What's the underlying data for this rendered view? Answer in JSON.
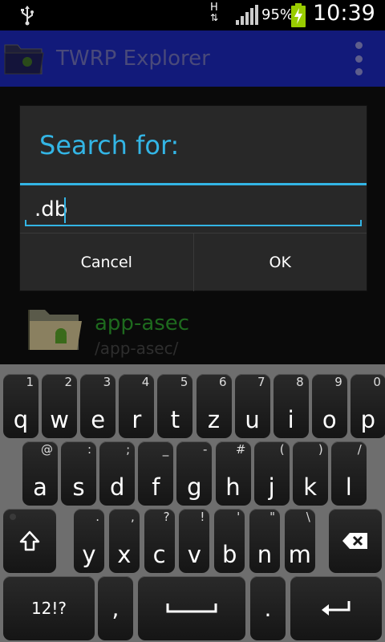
{
  "status_bar": {
    "network_type": "H",
    "battery_percent": "95%",
    "time": "10:39"
  },
  "app_bar": {
    "title": "TWRP Explorer"
  },
  "list": {
    "items": [
      {
        "name": "app-asec",
        "path": "/app-asec/"
      }
    ]
  },
  "dialog": {
    "title": "Search for:",
    "input_value": ".db",
    "cancel_label": "Cancel",
    "ok_label": "OK"
  },
  "keyboard": {
    "row1": [
      {
        "main": "q",
        "sub": "1"
      },
      {
        "main": "w",
        "sub": "2"
      },
      {
        "main": "e",
        "sub": "3"
      },
      {
        "main": "r",
        "sub": "4"
      },
      {
        "main": "t",
        "sub": "5"
      },
      {
        "main": "z",
        "sub": "6"
      },
      {
        "main": "u",
        "sub": "7"
      },
      {
        "main": "i",
        "sub": "8"
      },
      {
        "main": "o",
        "sub": "9"
      },
      {
        "main": "p",
        "sub": "0"
      }
    ],
    "row2": [
      {
        "main": "a",
        "sub": "@"
      },
      {
        "main": "s",
        "sub": ":"
      },
      {
        "main": "d",
        "sub": ";"
      },
      {
        "main": "f",
        "sub": "_"
      },
      {
        "main": "g",
        "sub": "-"
      },
      {
        "main": "h",
        "sub": "#"
      },
      {
        "main": "j",
        "sub": "("
      },
      {
        "main": "k",
        "sub": ")"
      },
      {
        "main": "l",
        "sub": "/"
      }
    ],
    "row3": [
      {
        "main": "y",
        "sub": "."
      },
      {
        "main": "x",
        "sub": ","
      },
      {
        "main": "c",
        "sub": "?"
      },
      {
        "main": "v",
        "sub": "!"
      },
      {
        "main": "b",
        "sub": "'"
      },
      {
        "main": "n",
        "sub": "\""
      },
      {
        "main": "m",
        "sub": "\\"
      }
    ],
    "symbols_label": "12!?",
    "comma_label": ",",
    "period_label": "."
  }
}
